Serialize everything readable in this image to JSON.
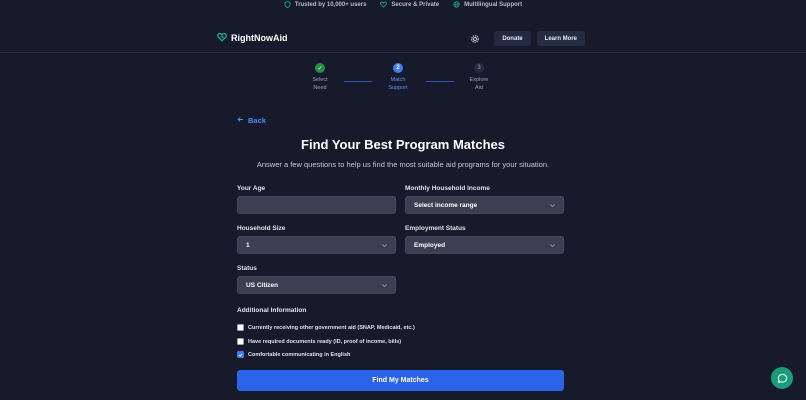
{
  "trust_bar": {
    "items": [
      {
        "icon": "shield-icon",
        "label": "Trusted by 10,000+ users"
      },
      {
        "icon": "heart-shield-icon",
        "label": "Secure & Private"
      },
      {
        "icon": "globe-icon",
        "label": "Multilingual Support"
      }
    ]
  },
  "header": {
    "brand": "RightNowAid",
    "donate_label": "Donate",
    "learn_more_label": "Learn More"
  },
  "stepper": {
    "steps": [
      {
        "number": "✓",
        "label_line1": "Select",
        "label_line2": "Need",
        "state": "done"
      },
      {
        "number": "2",
        "label_line1": "Match",
        "label_line2": "Support",
        "state": "active"
      },
      {
        "number": "3",
        "label_line1": "Explore",
        "label_line2": "Aid",
        "state": "todo"
      }
    ]
  },
  "main": {
    "back_label": "Back",
    "title": "Find Your Best Program Matches",
    "subtitle": "Answer a few questions to help us find the most suitable aid programs for your situation.",
    "fields": {
      "age": {
        "label": "Your Age",
        "value": ""
      },
      "income": {
        "label": "Monthly Household Income",
        "value": "Select income range"
      },
      "household": {
        "label": "Household Size",
        "value": "1"
      },
      "employment": {
        "label": "Employment Status",
        "value": "Employed"
      },
      "status": {
        "label": "Status",
        "value": "US Citizen"
      }
    },
    "additional": {
      "title": "Additional Information",
      "options": [
        {
          "label": "Currently receiving other government aid (SNAP, Medicaid, etc.)",
          "checked": false
        },
        {
          "label": "Have required documents ready (ID, proof of income, bills)",
          "checked": false
        },
        {
          "label": "Comfortable communicating in English",
          "checked": true
        }
      ]
    },
    "submit_label": "Find My Matches"
  },
  "colors": {
    "background": "#161a2b",
    "accent": "#2b64e8",
    "chat": "#1a9b7a"
  }
}
